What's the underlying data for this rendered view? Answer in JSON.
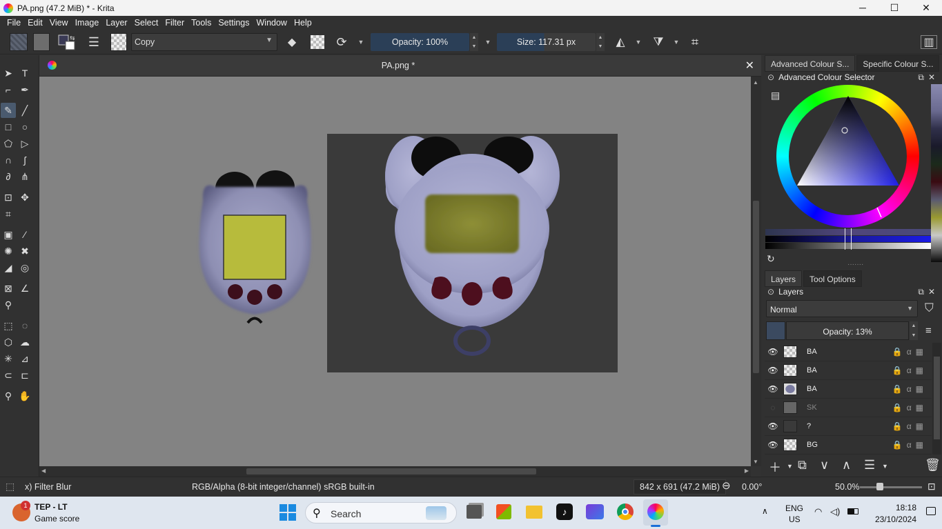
{
  "window": {
    "title": "PA.png (47.2 MiB)  * - Krita",
    "minimize": "─",
    "maximize": "☐",
    "close": "✕"
  },
  "menu": [
    "File",
    "Edit",
    "View",
    "Image",
    "Layer",
    "Select",
    "Filter",
    "Tools",
    "Settings",
    "Window",
    "Help"
  ],
  "toolbar": {
    "blend_mode": "Copy",
    "opacity": "Opacity: 100%",
    "size": "Size: 117.31 px"
  },
  "document": {
    "tab_title": "PA.png *",
    "close": "✕"
  },
  "dock": {
    "tabs": [
      "Advanced Colour S...",
      "Specific Colour S..."
    ],
    "color_panel_title": "Advanced Colour Selector",
    "layers_tabs": [
      "Layers",
      "Tool Options"
    ],
    "layers_title": "Layers",
    "blend": "Normal",
    "opacity": "Opacity:  13%",
    "layers": [
      {
        "name": "BA",
        "visible": true
      },
      {
        "name": "BA",
        "visible": true
      },
      {
        "name": "BA",
        "visible": true
      },
      {
        "name": "SK",
        "visible": false
      },
      {
        "name": "?",
        "visible": true
      },
      {
        "name": "BG",
        "visible": true
      }
    ]
  },
  "status": {
    "tool": "x) Filter Blur",
    "colorspace": "RGB/Alpha (8-bit integer/channel)  sRGB built-in",
    "dims": "842 x 691 (47.2 MiB)",
    "rotation": "0.00°",
    "zoom": "50.0%"
  },
  "taskbar": {
    "widget_title": "TEP - LT",
    "widget_sub": "Game score",
    "badge": "1",
    "search": "Search",
    "lang1": "ENG",
    "lang2": "US",
    "time": "18:18",
    "date": "23/10/2024"
  }
}
